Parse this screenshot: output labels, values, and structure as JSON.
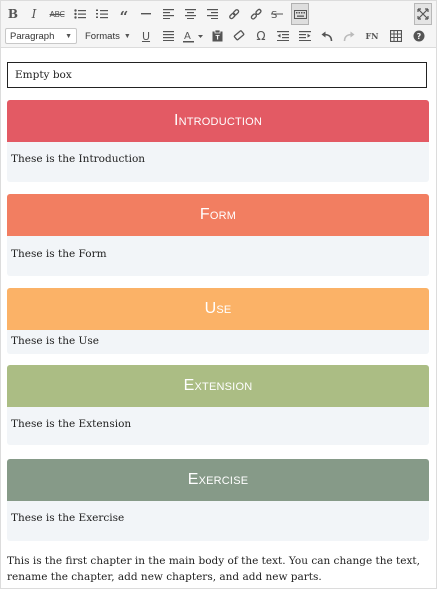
{
  "toolbar": {
    "format_select": "Paragraph",
    "formats_label": "Formats",
    "footnote_label": "FN",
    "icons": [
      "bold-icon",
      "italic-icon",
      "strikethrough-icon",
      "bullet-list-icon",
      "numbered-list-icon",
      "blockquote-icon",
      "horizontal-rule-icon",
      "align-left-icon",
      "align-center-icon",
      "align-right-icon",
      "link-icon",
      "unlink-icon",
      "keyboard-icon",
      "fullscreen-icon",
      "underline-icon",
      "justify-icon",
      "text-color-icon",
      "paste-text-icon",
      "clear-formatting-icon",
      "omega-icon",
      "outdent-icon",
      "indent-icon",
      "undo-icon",
      "redo-icon",
      "table-icon",
      "help-icon"
    ]
  },
  "content": {
    "empty_box": "Empty box",
    "sections": [
      {
        "title": "Introduction",
        "body": "These is the Introduction",
        "color": "#e35a64"
      },
      {
        "title": "Form",
        "body": "These is the Form",
        "color": "#f27e61"
      },
      {
        "title": "Use",
        "body": "These is the Use",
        "color": "#fbb267"
      },
      {
        "title": "Extension",
        "body": "These is the Extension",
        "color": "#abbd84"
      },
      {
        "title": "Exercise",
        "body": "These is the Exercise",
        "color": "#869a88"
      }
    ],
    "main_text": "This is the first chapter in the main body of the text. You can change the text, rename the chapter, add new chapters, and add new parts."
  }
}
